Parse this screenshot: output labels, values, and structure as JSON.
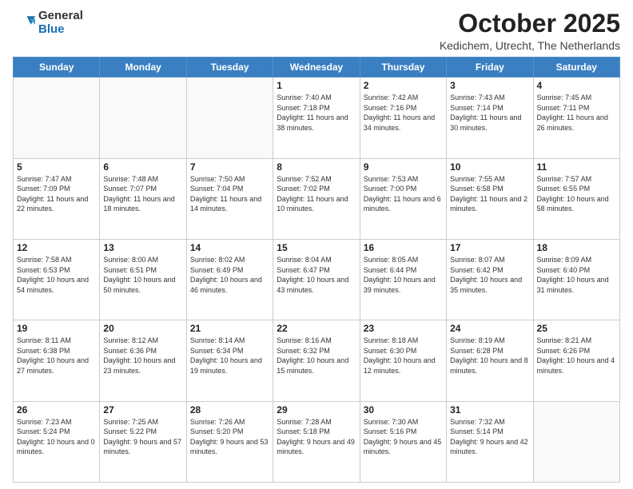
{
  "logo": {
    "general": "General",
    "blue": "Blue"
  },
  "header": {
    "month": "October 2025",
    "location": "Kedichem, Utrecht, The Netherlands"
  },
  "weekdays": [
    "Sunday",
    "Monday",
    "Tuesday",
    "Wednesday",
    "Thursday",
    "Friday",
    "Saturday"
  ],
  "weeks": [
    [
      {
        "day": "",
        "sunrise": "",
        "sunset": "",
        "daylight": ""
      },
      {
        "day": "",
        "sunrise": "",
        "sunset": "",
        "daylight": ""
      },
      {
        "day": "",
        "sunrise": "",
        "sunset": "",
        "daylight": ""
      },
      {
        "day": "1",
        "sunrise": "Sunrise: 7:40 AM",
        "sunset": "Sunset: 7:18 PM",
        "daylight": "Daylight: 11 hours and 38 minutes."
      },
      {
        "day": "2",
        "sunrise": "Sunrise: 7:42 AM",
        "sunset": "Sunset: 7:16 PM",
        "daylight": "Daylight: 11 hours and 34 minutes."
      },
      {
        "day": "3",
        "sunrise": "Sunrise: 7:43 AM",
        "sunset": "Sunset: 7:14 PM",
        "daylight": "Daylight: 11 hours and 30 minutes."
      },
      {
        "day": "4",
        "sunrise": "Sunrise: 7:45 AM",
        "sunset": "Sunset: 7:11 PM",
        "daylight": "Daylight: 11 hours and 26 minutes."
      }
    ],
    [
      {
        "day": "5",
        "sunrise": "Sunrise: 7:47 AM",
        "sunset": "Sunset: 7:09 PM",
        "daylight": "Daylight: 11 hours and 22 minutes."
      },
      {
        "day": "6",
        "sunrise": "Sunrise: 7:48 AM",
        "sunset": "Sunset: 7:07 PM",
        "daylight": "Daylight: 11 hours and 18 minutes."
      },
      {
        "day": "7",
        "sunrise": "Sunrise: 7:50 AM",
        "sunset": "Sunset: 7:04 PM",
        "daylight": "Daylight: 11 hours and 14 minutes."
      },
      {
        "day": "8",
        "sunrise": "Sunrise: 7:52 AM",
        "sunset": "Sunset: 7:02 PM",
        "daylight": "Daylight: 11 hours and 10 minutes."
      },
      {
        "day": "9",
        "sunrise": "Sunrise: 7:53 AM",
        "sunset": "Sunset: 7:00 PM",
        "daylight": "Daylight: 11 hours and 6 minutes."
      },
      {
        "day": "10",
        "sunrise": "Sunrise: 7:55 AM",
        "sunset": "Sunset: 6:58 PM",
        "daylight": "Daylight: 11 hours and 2 minutes."
      },
      {
        "day": "11",
        "sunrise": "Sunrise: 7:57 AM",
        "sunset": "Sunset: 6:55 PM",
        "daylight": "Daylight: 10 hours and 58 minutes."
      }
    ],
    [
      {
        "day": "12",
        "sunrise": "Sunrise: 7:58 AM",
        "sunset": "Sunset: 6:53 PM",
        "daylight": "Daylight: 10 hours and 54 minutes."
      },
      {
        "day": "13",
        "sunrise": "Sunrise: 8:00 AM",
        "sunset": "Sunset: 6:51 PM",
        "daylight": "Daylight: 10 hours and 50 minutes."
      },
      {
        "day": "14",
        "sunrise": "Sunrise: 8:02 AM",
        "sunset": "Sunset: 6:49 PM",
        "daylight": "Daylight: 10 hours and 46 minutes."
      },
      {
        "day": "15",
        "sunrise": "Sunrise: 8:04 AM",
        "sunset": "Sunset: 6:47 PM",
        "daylight": "Daylight: 10 hours and 43 minutes."
      },
      {
        "day": "16",
        "sunrise": "Sunrise: 8:05 AM",
        "sunset": "Sunset: 6:44 PM",
        "daylight": "Daylight: 10 hours and 39 minutes."
      },
      {
        "day": "17",
        "sunrise": "Sunrise: 8:07 AM",
        "sunset": "Sunset: 6:42 PM",
        "daylight": "Daylight: 10 hours and 35 minutes."
      },
      {
        "day": "18",
        "sunrise": "Sunrise: 8:09 AM",
        "sunset": "Sunset: 6:40 PM",
        "daylight": "Daylight: 10 hours and 31 minutes."
      }
    ],
    [
      {
        "day": "19",
        "sunrise": "Sunrise: 8:11 AM",
        "sunset": "Sunset: 6:38 PM",
        "daylight": "Daylight: 10 hours and 27 minutes."
      },
      {
        "day": "20",
        "sunrise": "Sunrise: 8:12 AM",
        "sunset": "Sunset: 6:36 PM",
        "daylight": "Daylight: 10 hours and 23 minutes."
      },
      {
        "day": "21",
        "sunrise": "Sunrise: 8:14 AM",
        "sunset": "Sunset: 6:34 PM",
        "daylight": "Daylight: 10 hours and 19 minutes."
      },
      {
        "day": "22",
        "sunrise": "Sunrise: 8:16 AM",
        "sunset": "Sunset: 6:32 PM",
        "daylight": "Daylight: 10 hours and 15 minutes."
      },
      {
        "day": "23",
        "sunrise": "Sunrise: 8:18 AM",
        "sunset": "Sunset: 6:30 PM",
        "daylight": "Daylight: 10 hours and 12 minutes."
      },
      {
        "day": "24",
        "sunrise": "Sunrise: 8:19 AM",
        "sunset": "Sunset: 6:28 PM",
        "daylight": "Daylight: 10 hours and 8 minutes."
      },
      {
        "day": "25",
        "sunrise": "Sunrise: 8:21 AM",
        "sunset": "Sunset: 6:26 PM",
        "daylight": "Daylight: 10 hours and 4 minutes."
      }
    ],
    [
      {
        "day": "26",
        "sunrise": "Sunrise: 7:23 AM",
        "sunset": "Sunset: 5:24 PM",
        "daylight": "Daylight: 10 hours and 0 minutes."
      },
      {
        "day": "27",
        "sunrise": "Sunrise: 7:25 AM",
        "sunset": "Sunset: 5:22 PM",
        "daylight": "Daylight: 9 hours and 57 minutes."
      },
      {
        "day": "28",
        "sunrise": "Sunrise: 7:26 AM",
        "sunset": "Sunset: 5:20 PM",
        "daylight": "Daylight: 9 hours and 53 minutes."
      },
      {
        "day": "29",
        "sunrise": "Sunrise: 7:28 AM",
        "sunset": "Sunset: 5:18 PM",
        "daylight": "Daylight: 9 hours and 49 minutes."
      },
      {
        "day": "30",
        "sunrise": "Sunrise: 7:30 AM",
        "sunset": "Sunset: 5:16 PM",
        "daylight": "Daylight: 9 hours and 45 minutes."
      },
      {
        "day": "31",
        "sunrise": "Sunrise: 7:32 AM",
        "sunset": "Sunset: 5:14 PM",
        "daylight": "Daylight: 9 hours and 42 minutes."
      },
      {
        "day": "",
        "sunrise": "",
        "sunset": "",
        "daylight": ""
      }
    ]
  ]
}
